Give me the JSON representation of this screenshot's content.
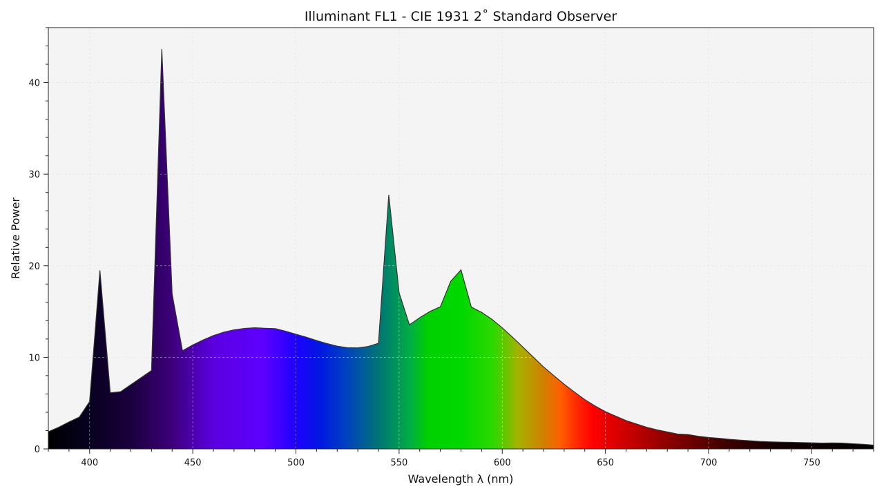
{
  "chart_data": {
    "type": "area",
    "title": "Illuminant FL1 - CIE 1931 2$^\\circ$ Standard Observer",
    "title_text": "Illuminant FL1 - CIE 1931 2˚ Standard Observer",
    "xlabel": "Wavelength λ (nm)",
    "ylabel": "Relative Power",
    "xlim": [
      380,
      780
    ],
    "ylim": [
      0,
      46
    ],
    "xticks": [
      400,
      450,
      500,
      550,
      600,
      650,
      700,
      750
    ],
    "yticks": [
      0,
      10,
      20,
      30,
      40
    ],
    "grid": true,
    "colors": {
      "plot_background": "#f4f4f4",
      "outline": "#333333",
      "grid": "#d8d8d8"
    },
    "series": [
      {
        "x": [
          380,
          385,
          390,
          395,
          400,
          405,
          410,
          415,
          420,
          425,
          430,
          435,
          440,
          445,
          450,
          455,
          460,
          465,
          470,
          475,
          480,
          485,
          490,
          495,
          500,
          505,
          510,
          515,
          520,
          525,
          530,
          535,
          540,
          545,
          550,
          555,
          560,
          565,
          570,
          575,
          580,
          585,
          590,
          595,
          600,
          605,
          610,
          615,
          620,
          625,
          630,
          635,
          640,
          645,
          650,
          655,
          660,
          665,
          670,
          675,
          680,
          685,
          690,
          695,
          700,
          705,
          710,
          715,
          720,
          725,
          730,
          735,
          740,
          745,
          750,
          755,
          760,
          765,
          770,
          775,
          780
        ],
        "values": [
          1.87,
          2.36,
          2.94,
          3.47,
          5.17,
          19.49,
          6.13,
          6.24,
          7.01,
          7.79,
          8.56,
          43.67,
          16.94,
          10.72,
          11.35,
          11.89,
          12.37,
          12.75,
          13.0,
          13.15,
          13.23,
          13.17,
          13.13,
          12.85,
          12.52,
          12.2,
          11.83,
          11.5,
          11.22,
          11.05,
          11.03,
          11.18,
          11.53,
          27.74,
          17.05,
          13.55,
          14.33,
          15.01,
          15.52,
          18.29,
          19.55,
          15.48,
          14.91,
          14.15,
          13.22,
          12.19,
          11.12,
          10.03,
          8.95,
          8.0,
          7.06,
          6.2,
          5.38,
          4.68,
          4.07,
          3.58,
          3.1,
          2.73,
          2.36,
          2.09,
          1.85,
          1.62,
          1.57,
          1.38,
          1.25,
          1.16,
          1.05,
          0.96,
          0.89,
          0.81,
          0.77,
          0.74,
          0.72,
          0.69,
          0.66,
          0.63,
          0.65,
          0.63,
          0.56,
          0.5,
          0.41
        ]
      }
    ]
  }
}
